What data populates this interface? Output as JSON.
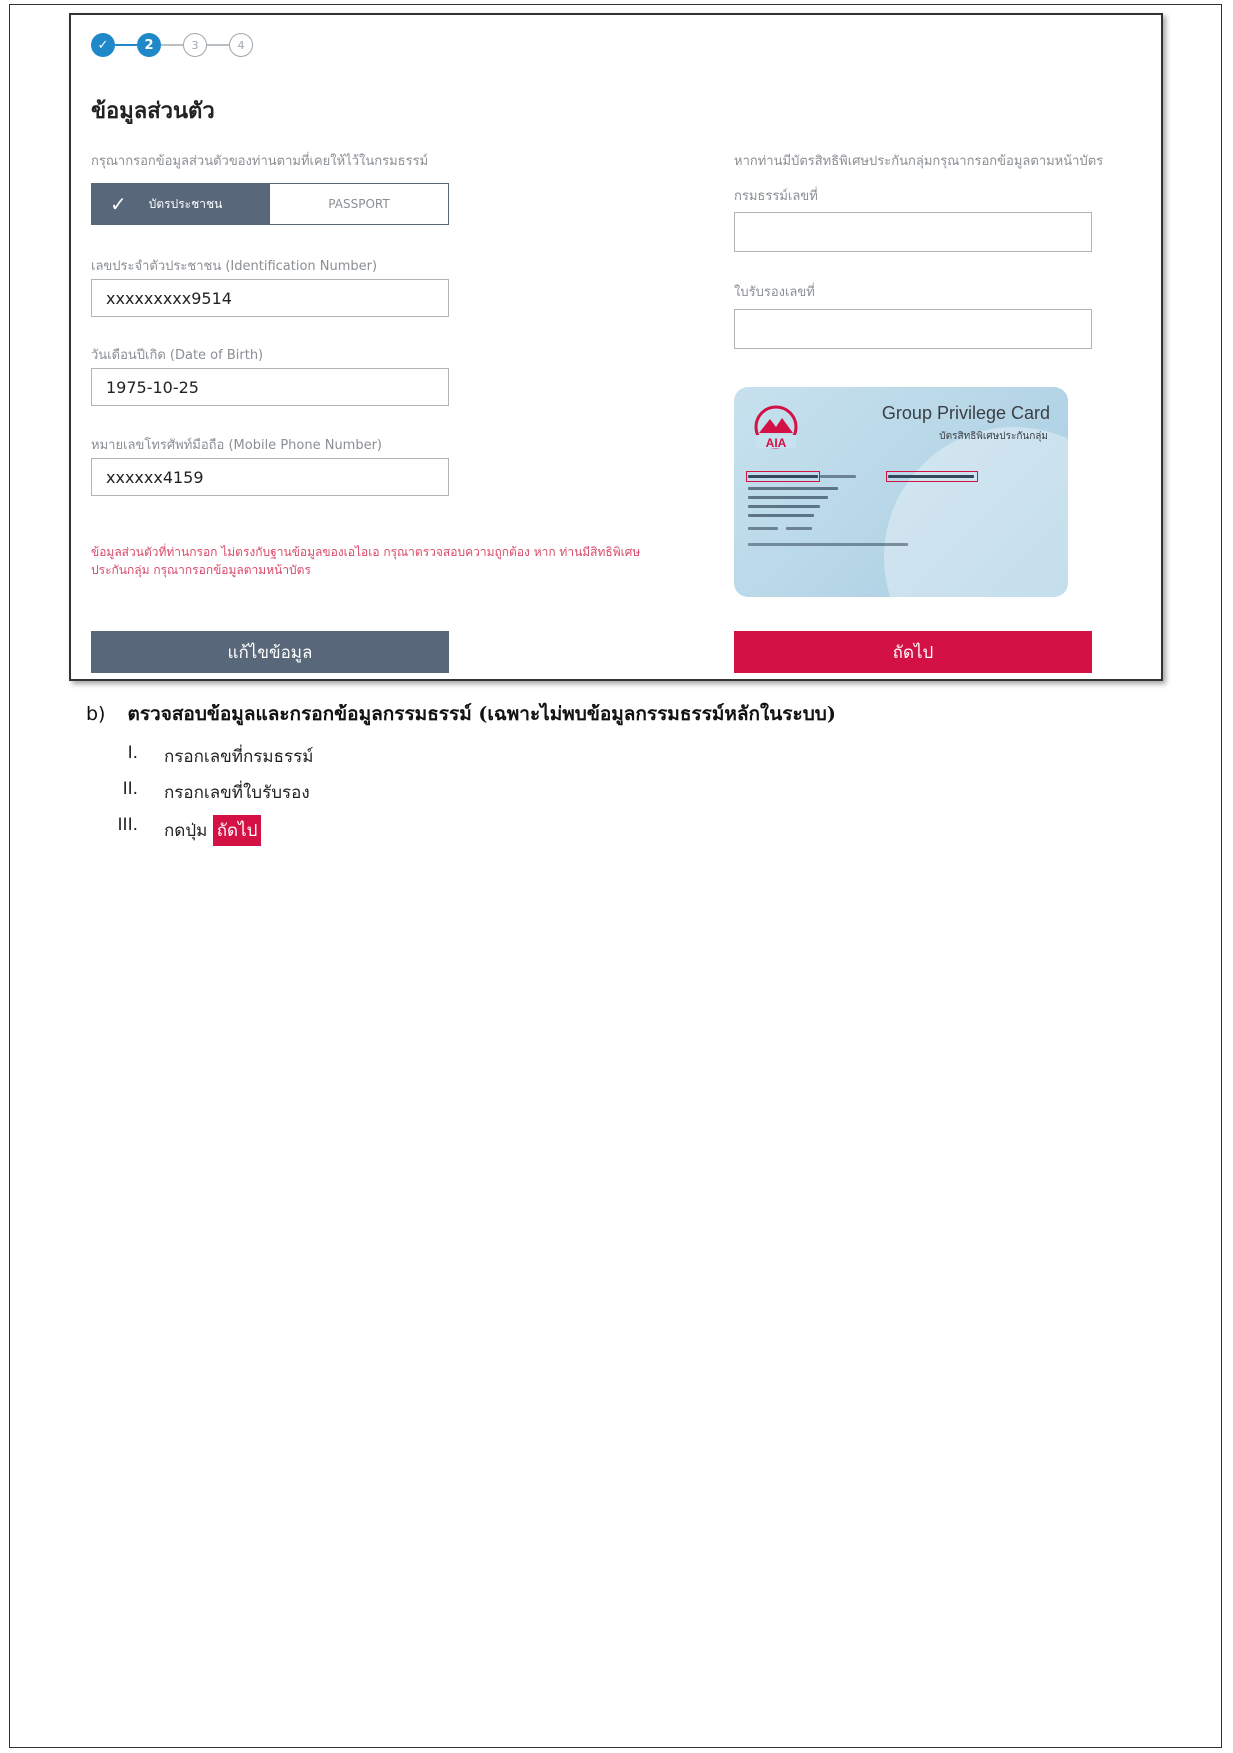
{
  "stepper": {
    "steps": [
      {
        "label": "✓",
        "state": "done"
      },
      {
        "label": "2",
        "state": "active"
      },
      {
        "label": "3",
        "state": "todo"
      },
      {
        "label": "4",
        "state": "todo"
      }
    ]
  },
  "form": {
    "title": "ข้อมูลส่วนตัว",
    "left_hint": "กรุณากรอกข้อมูลส่วนตัวของท่านตามที่เคยให้ไว้ในกรมธรรม์",
    "right_hint": "หากท่านมีบัตรสิทธิพิเศษประกันกลุ่มกรุณากรอกข้อมูลตามหน้าบัตร",
    "id_type_toggle": {
      "selected": "บัตรประชาชน",
      "other": "PASSPORT"
    },
    "id_number": {
      "label": "เลขประจำตัวประชาชน (Identification Number)",
      "value": "xxxxxxxxx9514"
    },
    "dob": {
      "label": "วันเดือนปีเกิด (Date of Birth)",
      "value": "1975-10-25"
    },
    "mobile": {
      "label": "หมายเลขโทรศัพท์มือถือ (Mobile Phone Number)",
      "value": "xxxxxx4159"
    },
    "policy_number": {
      "label": "กรมธรรม์เลขที่",
      "value": ""
    },
    "certificate_number": {
      "label": "ใบรับรองเลขที่",
      "value": ""
    },
    "error_message": "ข้อมูลส่วนตัวที่ท่านกรอก ไม่ตรงกับฐานข้อมูลของเอไอเอ กรุณาตรวจสอบความถูกต้อง หาก ท่านมีสิทธิพิเศษประกันกลุ่ม กรุณากรอกข้อมูลตามหน้าบัตร",
    "edit_button": "แก้ไขข้อมูล",
    "next_button": "ถัดไป"
  },
  "card": {
    "brand": "AIA",
    "title": "Group Privilege Card",
    "subtitle": "บัตรสิทธิพิเศษประกันกลุ่ม",
    "accent_color": "#d31145"
  },
  "instructions": {
    "letter": "b)",
    "heading": "ตรวจสอบข้อมูลและกรอกข้อมูลกรรมธรรม์ (เฉพาะไม่พบข้อมูลกรรมธรรม์หลักในระบบ)",
    "items": [
      {
        "num": "I.",
        "text": "กรอกเลขที่กรมธรรม์"
      },
      {
        "num": "II.",
        "text": "กรอกเลขที่ใบรับรอง"
      },
      {
        "num": "III.",
        "text": "กดปุ่ม",
        "chip": "ถัดไป"
      }
    ]
  }
}
